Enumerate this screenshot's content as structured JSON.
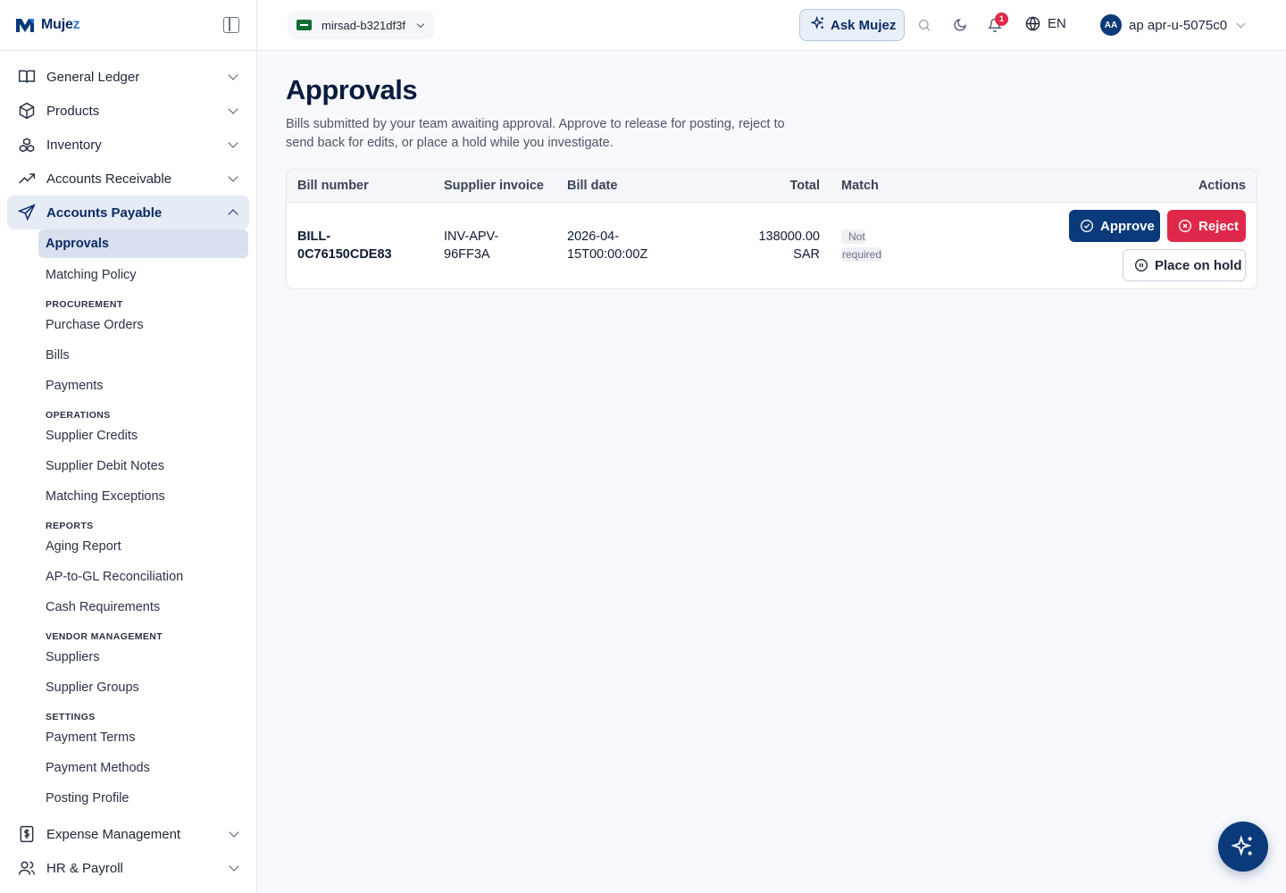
{
  "brand": {
    "name_main": "Muje",
    "name_accent": "z"
  },
  "nav": {
    "top_items": [
      {
        "label": "General Ledger",
        "icon": "book-icon"
      },
      {
        "label": "Products",
        "icon": "box-icon"
      },
      {
        "label": "Inventory",
        "icon": "boxes-icon"
      },
      {
        "label": "Accounts Receivable",
        "icon": "trending-up-icon"
      }
    ],
    "active_section": {
      "label": "Accounts Payable",
      "icon": "send-icon"
    },
    "sub": {
      "approvals": "Approvals",
      "matching_policy": "Matching Policy",
      "procurement_head": "PROCUREMENT",
      "purchase_orders": "Purchase Orders",
      "bills": "Bills",
      "payments": "Payments",
      "operations_head": "OPERATIONS",
      "supplier_credits": "Supplier Credits",
      "supplier_debit_notes": "Supplier Debit Notes",
      "matching_exceptions": "Matching Exceptions",
      "reports_head": "REPORTS",
      "aging_report": "Aging Report",
      "ap_gl_recon": "AP-to-GL Reconciliation",
      "cash_requirements": "Cash Requirements",
      "vendor_head": "VENDOR MANAGEMENT",
      "suppliers": "Suppliers",
      "supplier_groups": "Supplier Groups",
      "settings_head": "SETTINGS",
      "payment_terms": "Payment Terms",
      "payment_methods": "Payment Methods",
      "posting_profile": "Posting Profile"
    },
    "bottom_items": [
      {
        "label": "Expense Management",
        "icon": "dollar-doc-icon"
      },
      {
        "label": "HR & Payroll",
        "icon": "users-icon"
      }
    ]
  },
  "topbar": {
    "tenant": "mirsad-b321df3f",
    "ask_label": "Ask Mujez",
    "notification_count": "1",
    "language": "EN",
    "avatar_initials": "AA",
    "username": "ap apr-u-5075c0"
  },
  "page": {
    "title": "Approvals",
    "description": "Bills submitted by your team awaiting approval. Approve to release for posting, reject to send back for edits, or place a hold while you investigate."
  },
  "table": {
    "headers": {
      "bill_number": "Bill number",
      "supplier_invoice": "Supplier invoice",
      "bill_date": "Bill date",
      "total": "Total",
      "match": "Match",
      "actions": "Actions"
    },
    "rows": [
      {
        "bill_number_1": "BILL-",
        "bill_number_2": "0C76150CDE83",
        "supplier_invoice_1": "INV-APV-",
        "supplier_invoice_2": "96FF3A",
        "bill_date_1": "2026-04-",
        "bill_date_2": "15T00:00:00Z",
        "total_1": "138000.00",
        "total_2": "SAR",
        "match_1": "Not",
        "match_2": "required",
        "approve_label": "Approve",
        "reject_label": "Reject",
        "hold_label": "Place on hold"
      }
    ]
  },
  "colors": {
    "primary": "#0a3a7a",
    "danger": "#e0284a",
    "accent": "#2b7bd9"
  }
}
